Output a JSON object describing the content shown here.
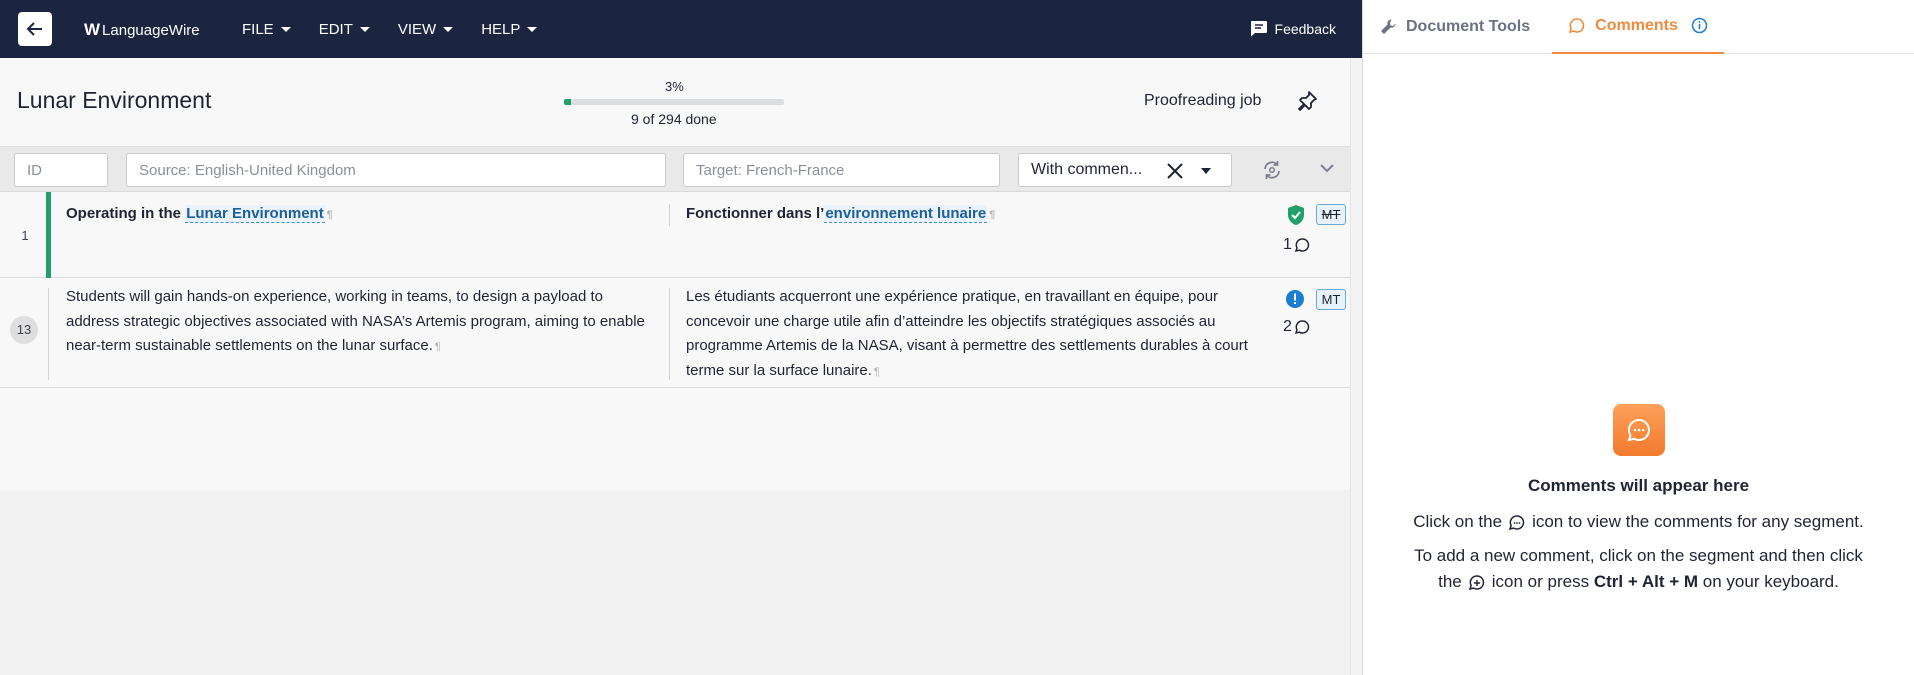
{
  "topbar": {
    "logo_text": "LanguageWire",
    "menu": [
      {
        "label": "FILE"
      },
      {
        "label": "EDIT"
      },
      {
        "label": "VIEW"
      },
      {
        "label": "HELP"
      }
    ],
    "feedback_label": "Feedback"
  },
  "header": {
    "title": "Lunar Environment",
    "progress_pct_label": "3%",
    "progress_fraction": 0.03,
    "progress_done_label": "9 of 294 done",
    "job_type": "Proofreading job"
  },
  "filters": {
    "id_placeholder": "ID",
    "source_placeholder": "Source: English-United Kingdom",
    "target_placeholder": "Target: French-France",
    "filter_value": "With commen..."
  },
  "segments": [
    {
      "number": "1",
      "source_prefix": "Operating in the ",
      "source_term": "Lunar Environment",
      "target_prefix": "Fonctionner dans l’",
      "target_term": "environnement lunaire",
      "mt_label": "MT",
      "comment_count": "1",
      "status": "confirmed"
    },
    {
      "number": "13",
      "source": "Students will gain hands-on experience, working in teams, to design a payload to address strategic objectives associated with NASA’s Artemis program, aiming to enable near-term sustainable settlements on the lunar surface.",
      "target": "Les étudiants acquerront une expérience pratique, en travaillant en équipe, pour concevoir une charge utile afin d’atteindre les objectifs stratégiques associés au programme Artemis de la NASA, visant à permettre des settlements durables à court terme sur la surface lunaire.",
      "mt_label": "MT",
      "comment_count": "2",
      "status": "warning"
    }
  ],
  "pilcrow": "¶",
  "right_panel": {
    "tabs": [
      {
        "label": "Document Tools"
      },
      {
        "label": "Comments"
      }
    ],
    "empty_title": "Comments will appear here",
    "line1_a": "Click on the",
    "line1_b": "icon to view the comments for any segment.",
    "line2_a": "To add a new comment, click on the segment and then click",
    "line3_a": "the",
    "line3_b": "icon or press",
    "line3_keys": "Ctrl + Alt + M",
    "line3_c": "on your keyboard."
  },
  "colors": {
    "topbar": "#1b2540",
    "accent": "#f08a3c",
    "confirmed": "#22a06b",
    "info": "#1a7fd1"
  }
}
